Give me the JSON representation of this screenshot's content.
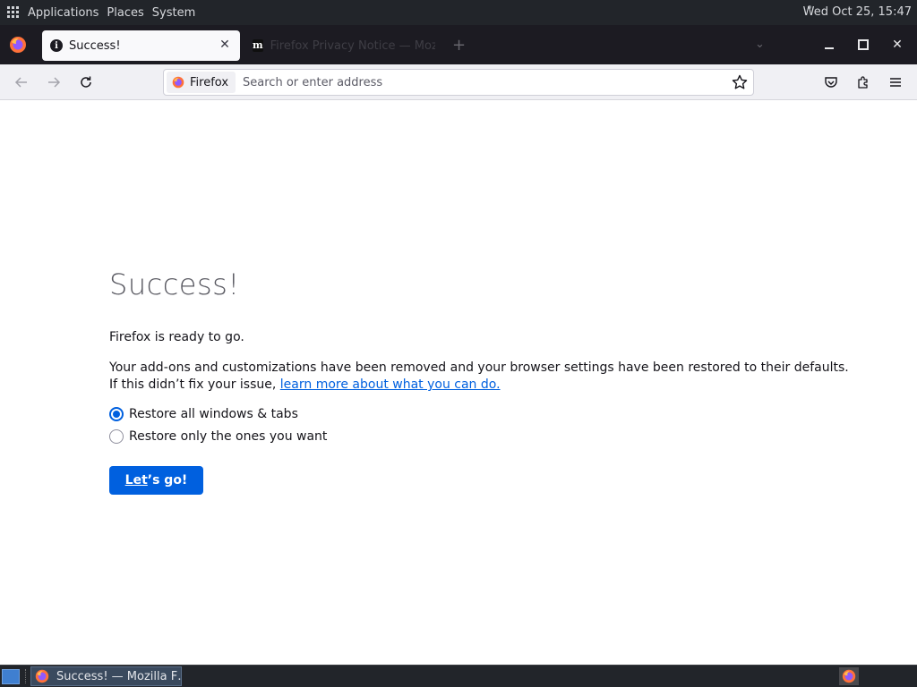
{
  "desktop": {
    "menu": [
      "Applications",
      "Places",
      "System"
    ],
    "clock": "Wed Oct 25, 15:47"
  },
  "browser": {
    "tabs": [
      {
        "title": "Success!",
        "active": true
      },
      {
        "title": "Firefox Privacy Notice — Mozilla",
        "active": false
      }
    ],
    "identity_label": "Firefox",
    "url_placeholder": "Search or enter address"
  },
  "page": {
    "heading": "Success!",
    "ready_text": "Firefox is ready to go.",
    "removed_text": "Your add-ons and customizations have been removed and your browser settings have been restored to their defaults.",
    "issue_text": "If this didn’t fix your issue,",
    "learn_link": "learn more about what you can do.",
    "options": [
      {
        "label": "Restore all windows & tabs",
        "checked": true
      },
      {
        "label": "Restore only the ones you want",
        "checked": false
      }
    ],
    "button_prefix": "Let",
    "button_suffix": "’s go!"
  },
  "taskbar": {
    "task_label": "Success! — Mozilla F…"
  },
  "colors": {
    "accent": "#0060df",
    "tabstrip": "#1c1b22",
    "toolbar": "#f0f0f4",
    "panel": "#22252a"
  }
}
